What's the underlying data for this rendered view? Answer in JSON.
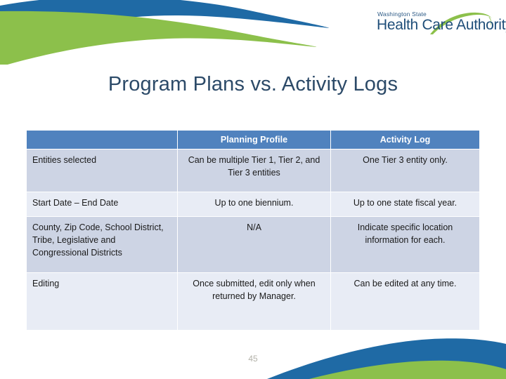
{
  "logo": {
    "top_line": "Washington State",
    "main_line": "Health Care Authority",
    "swoosh_color": "#8CC04B",
    "text_color": "#1f4e79"
  },
  "title": "Program Plans vs. Activity Logs",
  "theme": {
    "header_blue": "#5082BE",
    "row_dark": "#CDD4E4",
    "row_light": "#E8ECF5",
    "title_color": "#2C4A68",
    "wave_blue": "#1F6AA5",
    "wave_green": "#8CC04B",
    "background_bottom": "#ECEADF"
  },
  "table": {
    "headers": [
      "",
      "Planning Profile",
      "Activity Log"
    ],
    "rows": [
      {
        "label": "Entities selected",
        "planning_profile": "Can be multiple Tier 1, Tier 2, and Tier 3 entities",
        "activity_log": "One Tier 3 entity only."
      },
      {
        "label": "Start Date – End Date",
        "planning_profile": "Up to one biennium.",
        "activity_log": "Up to one state fiscal year."
      },
      {
        "label": "County, Zip Code, School District, Tribe, Legislative and Congressional Districts",
        "planning_profile": "N/A",
        "activity_log": "Indicate specific location information for each."
      },
      {
        "label": "Editing",
        "planning_profile": "Once submitted, edit only when returned by Manager.",
        "activity_log": "Can be edited at any time."
      }
    ]
  },
  "page_number": "45"
}
